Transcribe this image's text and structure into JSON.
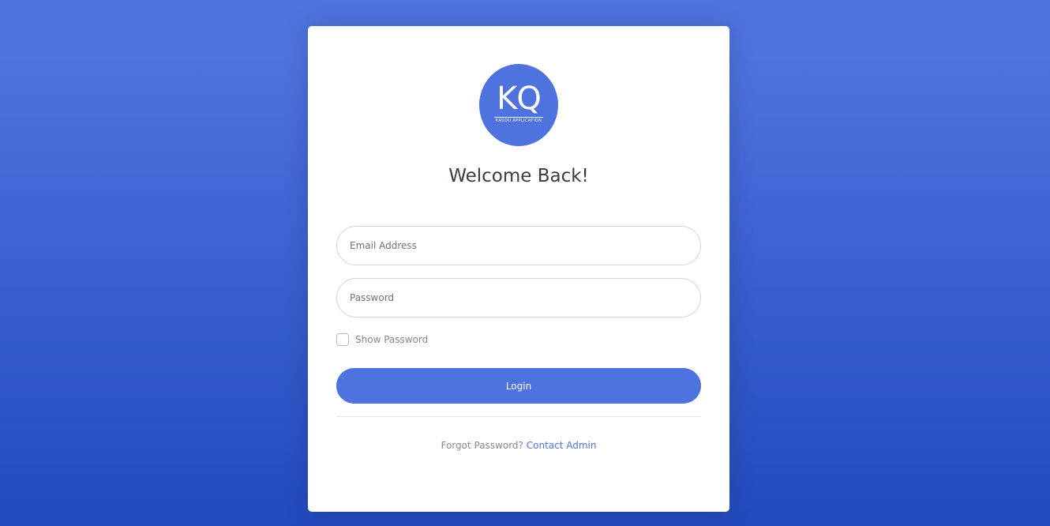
{
  "logo": {
    "mark": "KQ",
    "subtitle": "KASQU APPLICATION"
  },
  "page": {
    "title": "Welcome Back!"
  },
  "form": {
    "email_placeholder": "Email Address",
    "password_placeholder": "Password",
    "show_password_label": "Show Password",
    "show_password_checked": false,
    "login_label": "Login"
  },
  "footer": {
    "prefix": "Forgot Password?",
    "link_label": "Contact Admin"
  },
  "colors": {
    "primary": "#4e73df",
    "background_top": "#4e73df",
    "background_bottom": "#224abe",
    "card": "#ffffff"
  }
}
